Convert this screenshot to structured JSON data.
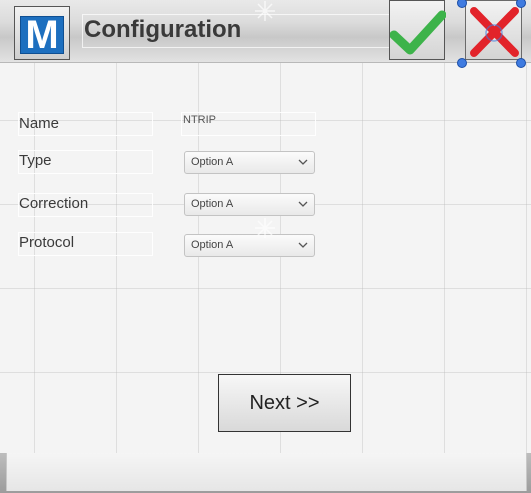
{
  "header": {
    "logo_letter": "M",
    "title": "Configuration",
    "accept_icon": "checkmark-icon",
    "cancel_icon": "close-x-icon"
  },
  "form": {
    "fields": [
      {
        "label": "Name",
        "value": "NTRIP"
      },
      {
        "label": "Type",
        "selected": "Option A"
      },
      {
        "label": "Correction",
        "selected": "Option A"
      },
      {
        "label": "Protocol",
        "selected": "Option A"
      }
    ]
  },
  "footer": {
    "next_label": "Next >>"
  },
  "colors": {
    "logo_blue": "#1d6fbf",
    "accept_green": "#3db34a",
    "cancel_red": "#e2232a",
    "selection_handle": "#3f7be0"
  }
}
